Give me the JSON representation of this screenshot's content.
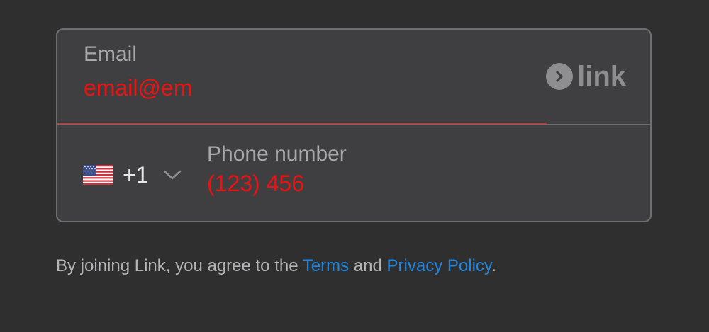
{
  "form": {
    "email": {
      "label": "Email",
      "value": "email@em"
    },
    "link_badge": {
      "text": "link",
      "icon": "chevron-circle-icon"
    },
    "phone": {
      "country_flag": "us-flag-icon",
      "dial_code": "+1",
      "label": "Phone number",
      "value": "(123) 456"
    }
  },
  "terms": {
    "prefix": "By joining Link, you agree to the ",
    "terms_link": "Terms",
    "middle": " and ",
    "privacy_link": "Privacy Policy",
    "suffix": "."
  },
  "colors": {
    "background": "#2f2f2f",
    "card": "#3f3f41",
    "border": "#6e6e70",
    "error": "#ee1111",
    "link": "#1f86e0",
    "label": "#a8a8aa"
  }
}
